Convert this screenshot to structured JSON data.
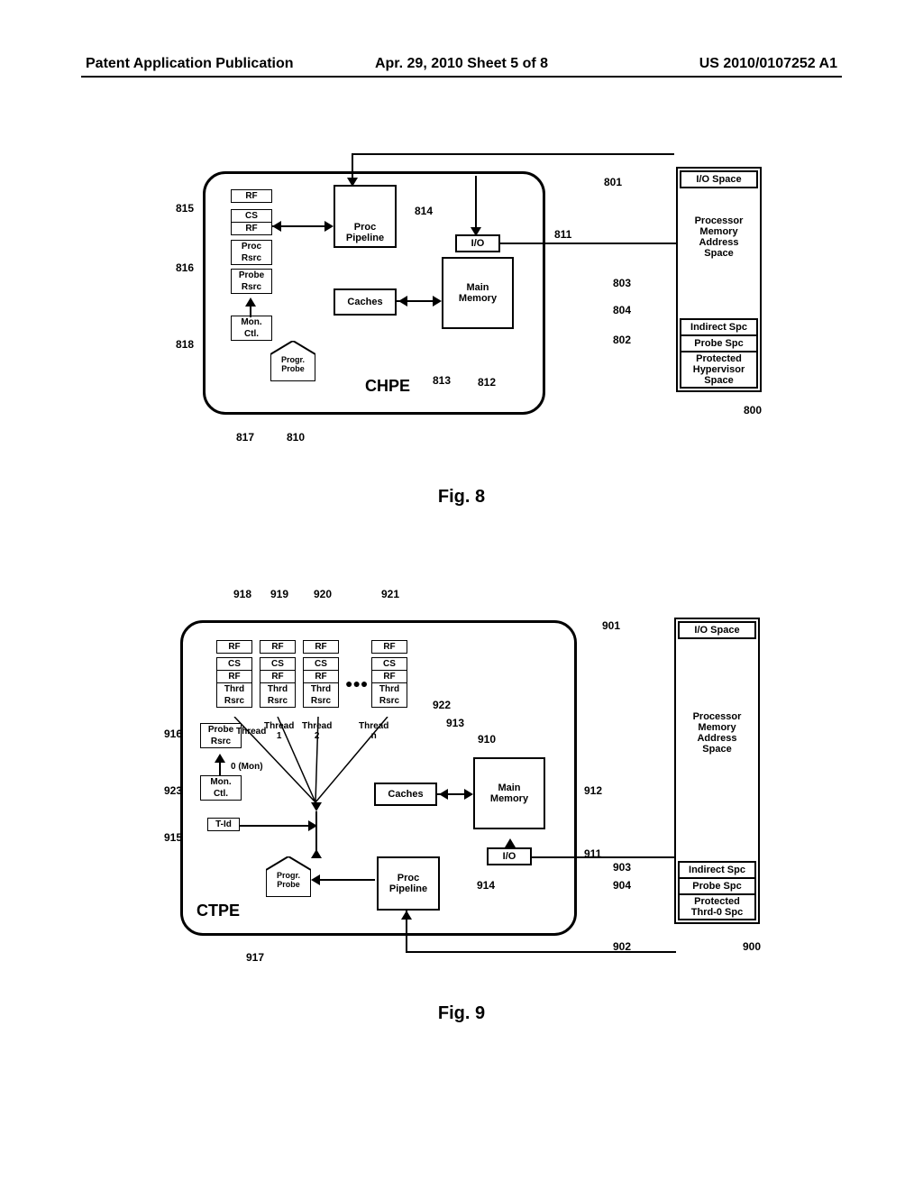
{
  "header": {
    "left": "Patent Application Publication",
    "center": "Apr. 29, 2010  Sheet 5 of 8",
    "right": "US 2010/0107252 A1"
  },
  "fig8": {
    "caption": "Fig. 8",
    "chip_label": "CHPE",
    "refs": {
      "r800": "800",
      "r801": "801",
      "r802": "802",
      "r803": "803",
      "r804": "804",
      "r810": "810",
      "r811": "811",
      "r812": "812",
      "r813": "813",
      "r814": "814",
      "r815": "815",
      "r816": "816",
      "r817": "817",
      "r818": "818"
    },
    "regs": {
      "rf": "RF",
      "csrf1": "CS",
      "csrf2": "RF",
      "proc_rsrc1": "Proc",
      "proc_rsrc2": "Rsrc",
      "probe_rsrc1": "Probe",
      "probe_rsrc2": "Rsrc",
      "mon1": "Mon.",
      "mon2": "Ctl."
    },
    "blocks": {
      "proc_pipeline1": "Proc",
      "proc_pipeline2": "Pipeline",
      "caches": "Caches",
      "main_mem1": "Main",
      "main_mem2": "Memory",
      "io": "I/O",
      "progr_probe1": "Progr.",
      "progr_probe2": "Probe"
    },
    "mem": {
      "io_space": "I/O Space",
      "addr1": "Processor",
      "addr2": "Memory",
      "addr3": "Address",
      "addr4": "Space",
      "indirect": "Indirect Spc",
      "probe": "Probe Spc",
      "protected1": "Protected",
      "protected2": "Hypervisor",
      "protected3": "Space"
    }
  },
  "fig9": {
    "caption": "Fig. 9",
    "chip_label": "CTPE",
    "refs": {
      "r900": "900",
      "r901": "901",
      "r902": "902",
      "r903": "903",
      "r904": "904",
      "r910": "910",
      "r911": "911",
      "r912": "912",
      "r913": "913",
      "r914": "914",
      "r915": "915",
      "r916": "916",
      "r917": "917",
      "r918": "918",
      "r919": "919",
      "r920": "920",
      "r921": "921",
      "r922": "922",
      "r923": "923"
    },
    "regs": {
      "rf": "RF",
      "csrf1": "CS",
      "csrf2": "RF",
      "thrd1": "Thrd",
      "thrd2": "Rsrc",
      "probe_rsrc1": "Probe",
      "probe_rsrc2": "Rsrc",
      "mon1": "Mon.",
      "mon2": "Ctl.",
      "tid": "T-Id"
    },
    "threads": {
      "t0a": "Thread",
      "t0b": "0 (Mon)",
      "t1a": "Thread",
      "t1b": "1",
      "t2a": "Thread",
      "t2b": "2",
      "tna": "Thread",
      "tnb": "n",
      "dots": "●●●"
    },
    "blocks": {
      "proc_pipeline1": "Proc",
      "proc_pipeline2": "Pipeline",
      "caches": "Caches",
      "main_mem1": "Main",
      "main_mem2": "Memory",
      "io": "I/O",
      "progr_probe1": "Progr.",
      "progr_probe2": "Probe"
    },
    "mem": {
      "io_space": "I/O Space",
      "addr1": "Processor",
      "addr2": "Memory",
      "addr3": "Address",
      "addr4": "Space",
      "indirect": "Indirect Spc",
      "probe": "Probe Spc",
      "protected1": "Protected",
      "protected2": "Thrd-0 Spc"
    }
  }
}
